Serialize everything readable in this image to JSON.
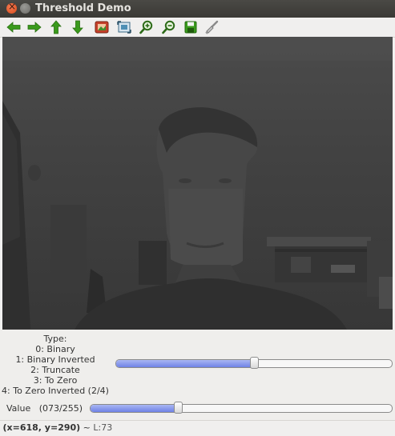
{
  "window": {
    "title": "Threshold Demo"
  },
  "toolbar": {
    "buttons": [
      {
        "name": "pan-left-icon"
      },
      {
        "name": "pan-right-icon"
      },
      {
        "name": "pan-up-icon"
      },
      {
        "name": "pan-down-icon"
      },
      {
        "name": "zoom-original-icon"
      },
      {
        "name": "zoom-fit-icon"
      },
      {
        "name": "zoom-in-icon"
      },
      {
        "name": "zoom-out-icon"
      },
      {
        "name": "save-icon"
      },
      {
        "name": "properties-icon"
      }
    ]
  },
  "trackbars": {
    "type": {
      "lines": [
        "Type:",
        "0: Binary",
        "1: Binary Inverted",
        "2: Truncate",
        "3: To Zero",
        "4: To Zero Inverted (2/4)"
      ],
      "value": 2,
      "max": 4
    },
    "value": {
      "label": "Value",
      "readout": "(073/255)",
      "value": 73,
      "max": 255
    }
  },
  "status": {
    "coords": "(x=618, y=290)",
    "separator": " ~ ",
    "level": "L:73"
  },
  "colors": {
    "slider_fill": "#6f82e6",
    "image_background": "#3e3e3e",
    "titlebar": "#3c3b37"
  }
}
